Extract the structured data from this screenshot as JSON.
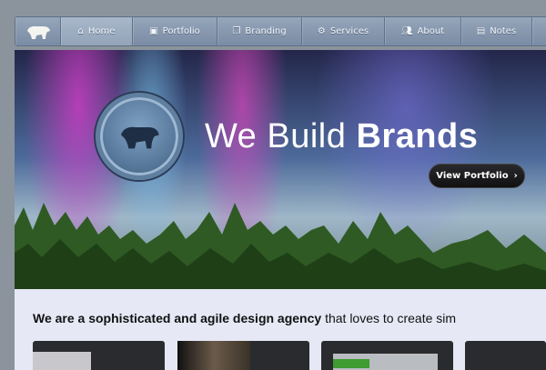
{
  "nav": {
    "items": [
      {
        "label": "Home",
        "icon": "home-icon",
        "active": true
      },
      {
        "label": "Portfolio",
        "icon": "image-icon"
      },
      {
        "label": "Branding",
        "icon": "cards-icon"
      },
      {
        "label": "Services",
        "icon": "gear-icon"
      },
      {
        "label": "About",
        "icon": "people-icon"
      },
      {
        "label": "Notes",
        "icon": "notepad-icon"
      }
    ]
  },
  "hero": {
    "headline_light": "We Build ",
    "headline_bold": "Brands",
    "button": "View Portfolio"
  },
  "intro": {
    "bold": "We are a sophisticated and agile design agency",
    "rest": " that loves to create sim"
  },
  "colors": {
    "nav": "#8797ad",
    "content_bg": "#e6e8f5",
    "button": "#1c1c1f"
  }
}
